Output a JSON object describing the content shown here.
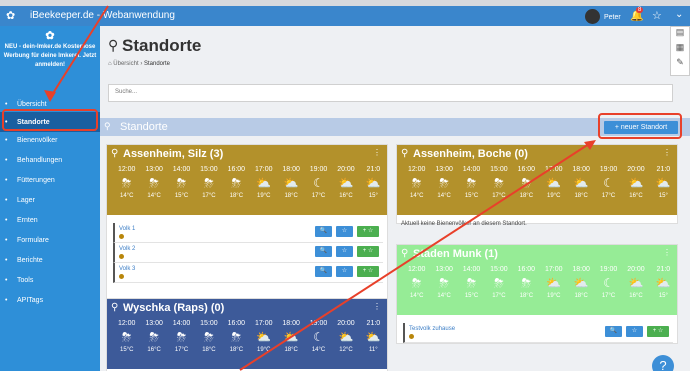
{
  "topbar": {
    "title": "iBeekeeper.de - Webanwendung",
    "user": "Peter",
    "badge": "8"
  },
  "promo": {
    "text": "NEU - dein-Imker.de Kostenlose Werbung für deine Imkerei. Jetzt anmelden!"
  },
  "sidebar": {
    "items": [
      {
        "label": "Übersicht",
        "icon": "home-icon"
      },
      {
        "label": "Standorte",
        "icon": "pin-icon"
      },
      {
        "label": "Bienenvölker",
        "icon": "hive-icon"
      },
      {
        "label": "Behandlungen",
        "icon": "medkit-icon"
      },
      {
        "label": "Fütterungen",
        "icon": "feed-icon"
      },
      {
        "label": "Lager",
        "icon": "box-icon"
      },
      {
        "label": "Ernten",
        "icon": "harvest-icon"
      },
      {
        "label": "Formulare",
        "icon": "form-icon"
      },
      {
        "label": "Berichte",
        "icon": "report-icon"
      },
      {
        "label": "Tools",
        "icon": "tools-icon"
      },
      {
        "label": "APITags",
        "icon": "tag-icon"
      }
    ]
  },
  "page": {
    "title": "Standorte",
    "breadcrumb_home": "Übersicht",
    "breadcrumb_current": "Standorte",
    "search_placeholder": "Suche...",
    "section_title": "Standorte",
    "new_button": "+ neuer Standort"
  },
  "cards": [
    {
      "title": "Assenheim, Silz (3)",
      "color": "#b3912b",
      "hours": [
        "12:00",
        "13:00",
        "14:00",
        "15:00",
        "16:00",
        "17:00",
        "18:00",
        "19:00",
        "20:00",
        "21:0"
      ],
      "icons": [
        "⛈",
        "⛈",
        "⛈",
        "⛈",
        "⛈",
        "⛅",
        "⛅",
        "☾",
        "⛅",
        "⛅"
      ],
      "temps": [
        "14°C",
        "14°C",
        "15°C",
        "17°C",
        "18°C",
        "19°C",
        "18°C",
        "17°C",
        "16°C",
        "15°"
      ],
      "rows": [
        {
          "label": "Volk 1"
        },
        {
          "label": "Volk 2"
        },
        {
          "label": "Volk 3"
        }
      ]
    },
    {
      "title": "Assenheim, Boche (0)",
      "color": "#b3912b",
      "hours": [
        "12:00",
        "13:00",
        "14:00",
        "15:00",
        "16:00",
        "17:00",
        "18:00",
        "19:00",
        "20:00",
        "21:0"
      ],
      "icons": [
        "⛈",
        "⛈",
        "⛈",
        "⛈",
        "⛈",
        "⛅",
        "⛅",
        "☾",
        "⛅",
        "⛅"
      ],
      "temps": [
        "14°C",
        "14°C",
        "15°C",
        "17°C",
        "18°C",
        "19°C",
        "18°C",
        "17°C",
        "16°C",
        "15°"
      ],
      "empty": "Aktuell keine Bienenvölker an diesem Standort."
    },
    {
      "title": "Staden Munk (1)",
      "color": "#96ec96",
      "hours": [
        "12:00",
        "13:00",
        "14:00",
        "15:00",
        "16:00",
        "17:00",
        "18:00",
        "19:00",
        "20:00",
        "21:0"
      ],
      "icons": [
        "⛈",
        "⛈",
        "⛈",
        "⛈",
        "⛈",
        "⛅",
        "⛅",
        "☾",
        "⛅",
        "⛅"
      ],
      "temps": [
        "14°C",
        "14°C",
        "15°C",
        "17°C",
        "18°C",
        "19°C",
        "18°C",
        "17°C",
        "16°C",
        "15°"
      ],
      "rows": [
        {
          "label": "Testvolk zuhause"
        }
      ]
    },
    {
      "title": "Wyschka (Raps) (0)",
      "color": "#3d5a99",
      "hours": [
        "12:00",
        "13:00",
        "14:00",
        "15:00",
        "16:00",
        "17:00",
        "18:00",
        "19:00",
        "20:00",
        "21:0"
      ],
      "icons": [
        "⛈",
        "⛈",
        "⛈",
        "⛈",
        "⛈",
        "⛅",
        "⛅",
        "☾",
        "⛅",
        "⛅"
      ],
      "temps": [
        "15°C",
        "16°C",
        "17°C",
        "18°C",
        "18°C",
        "19°C",
        "18°C",
        "14°C",
        "12°C",
        "11°"
      ]
    }
  ],
  "row_buttons": {
    "search": "🔍",
    "star": "☆",
    "add": "+ ☆"
  }
}
